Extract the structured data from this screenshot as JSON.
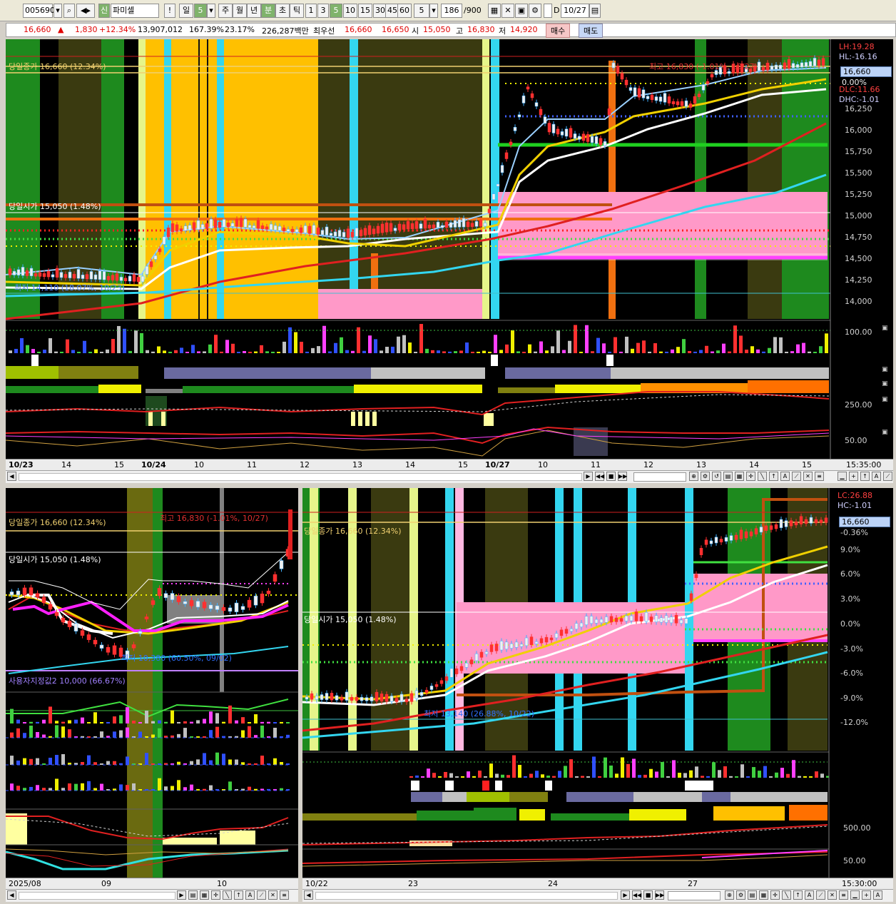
{
  "toolbar": {
    "code": "005690",
    "market": "신",
    "name": "파미셀",
    "period_day": "일",
    "period_day_n": "5",
    "periods": [
      "주",
      "월",
      "년",
      "분",
      "초",
      "틱"
    ],
    "minute_buttons": [
      "1",
      "3",
      "5",
      "10",
      "15",
      "30",
      "45",
      "60"
    ],
    "interval": "5",
    "count": "186",
    "count_total": "/900",
    "date_check": "D",
    "date": "10/27"
  },
  "quote": {
    "price": "16,660",
    "arrow": "▲",
    "change": "1,830",
    "change_pct": "+12.34%",
    "volume": "13,907,012",
    "vol_ratio": "167.39%",
    "turnover_pct": "23.17%",
    "amount": "226,287백만",
    "best_ask_label": "최우선",
    "best_ask": "16,660",
    "best_bid": "16,650",
    "open_label": "시",
    "open": "15,050",
    "high_label": "고",
    "high": "16,830",
    "low_label": "저",
    "low": "14,920",
    "buy_button": "매수",
    "sell_button": "매도"
  },
  "top_chart": {
    "close_label": "당일종가 16,660 (12.34%)",
    "open_label": "당일시가 15,050 (1.48%)",
    "high_note": "최고 16,830 (-1.01%, 10/27)",
    "low_note": "최저 14,110 (18.07%, 10/23)",
    "right_labels": [
      "LH:19.28",
      "HL:-16.16",
      "0.00%",
      "DLC:11.66",
      "DHC:-1.01"
    ],
    "price_box": "16,660",
    "y_ticks": [
      "16,250",
      "16,000",
      "15,750",
      "15,500",
      "15,250",
      "15,000",
      "14,750",
      "14,500",
      "14,250",
      "14,000"
    ],
    "vol_tick": "100.00",
    "ind_tick1": "250.00",
    "ind_tick2": "50.00",
    "x_ticks": [
      "10/23",
      "14",
      "15",
      "10/24",
      "10",
      "11",
      "12",
      "13",
      "14",
      "15",
      "10/27",
      "10",
      "11",
      "12",
      "13",
      "14",
      "15"
    ],
    "time": "15:35:00"
  },
  "bottom_left": {
    "close_label": "당일종가 16,660 (12.34%)",
    "open_label": "당일시가 15,050 (1.48%)",
    "high_note": "최고 16,830 (-1.01%, 10/27)",
    "low_note": "최저 10,380 (60.50%, 09/02)",
    "user_line": "사용자지정값2 10,000 (66.67%)",
    "x_ticks": [
      "2025/08",
      "09",
      "10"
    ]
  },
  "bottom_right": {
    "close_label": "당일종가 16,660 (12.34%)",
    "open_label": "당일시가 15,050 (1.48%)",
    "low_note": "최저 13,140 (26.88%, 10/22)",
    "right_labels": [
      "LC:26.88",
      "HC:-1.01"
    ],
    "price_box": "16,660",
    "y_ticks": [
      "-0.36%",
      "9.0%",
      "6.0%",
      "3.0%",
      "0.0%",
      "-3.0%",
      "-6.0%",
      "-9.0%",
      "-12.0%"
    ],
    "ind_tick1": "500.00",
    "ind_tick2": "50.00",
    "x_ticks": [
      "10/22",
      "23",
      "24",
      "27"
    ],
    "time": "15:30:00"
  },
  "colors": {
    "background": "#000000",
    "highlight_orange": "#ffc000",
    "cyan": "#33d6f0",
    "green_band": "#1e8a1e",
    "pink_zone": "#ff99c8",
    "ma_red": "#e02020",
    "ma_yellow": "#f0d000",
    "ma_white": "#ffffff"
  }
}
